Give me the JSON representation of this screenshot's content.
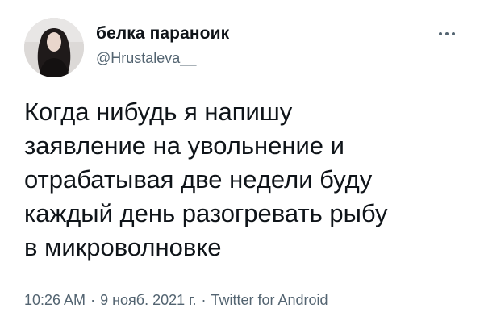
{
  "author": {
    "display_name": "белка параноик",
    "handle": "@Hrustaleva__"
  },
  "tweet": {
    "lines": [
      "Когда нибудь я напишу",
      "заявление на увольнение и",
      "отрабатывая две недели буду",
      "каждый день разогревать рыбу",
      "в микроволновке"
    ]
  },
  "meta": {
    "time": "10:26 AM",
    "separator": "·",
    "date": "9 нояб. 2021 г.",
    "source": "Twitter for Android"
  },
  "icons": {
    "more": "more-horizontal-icon"
  },
  "colors": {
    "text": "#0f1419",
    "secondary": "#536471",
    "background": "#ffffff"
  }
}
